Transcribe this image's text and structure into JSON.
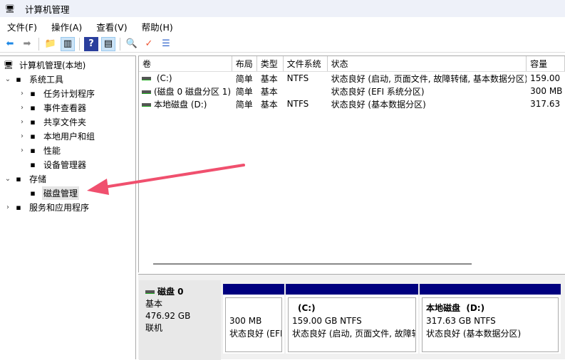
{
  "window": {
    "title": "计算机管理"
  },
  "menu": [
    "文件(F)",
    "操作(A)",
    "查看(V)",
    "帮助(H)"
  ],
  "tree": [
    {
      "label": "计算机管理(本地)",
      "icon": "computer-icon",
      "level": 0,
      "chev": ""
    },
    {
      "label": "系统工具",
      "icon": "tools-icon",
      "level": 1,
      "chev": "⌄"
    },
    {
      "label": "任务计划程序",
      "icon": "clock-icon",
      "level": 2,
      "chev": "›"
    },
    {
      "label": "事件查看器",
      "icon": "event-viewer-icon",
      "level": 2,
      "chev": "›"
    },
    {
      "label": "共享文件夹",
      "icon": "shared-folder-icon",
      "level": 2,
      "chev": "›"
    },
    {
      "label": "本地用户和组",
      "icon": "users-icon",
      "level": 2,
      "chev": "›"
    },
    {
      "label": "性能",
      "icon": "performance-icon",
      "level": 2,
      "chev": "›"
    },
    {
      "label": "设备管理器",
      "icon": "device-manager-icon",
      "level": 2,
      "chev": ""
    },
    {
      "label": "存储",
      "icon": "storage-icon",
      "level": 1,
      "chev": "⌄"
    },
    {
      "label": "磁盘管理",
      "icon": "disk-icon",
      "level": 2,
      "chev": "",
      "selected": true
    },
    {
      "label": "服务和应用程序",
      "icon": "services-icon",
      "level": 1,
      "chev": "›"
    }
  ],
  "table": {
    "columns": [
      "卷",
      "布局",
      "类型",
      "文件系统",
      "状态",
      "容量"
    ],
    "rows": [
      [
        " (C:)",
        "简单",
        "基本",
        "NTFS",
        "状态良好 (启动, 页面文件, 故障转储, 基本数据分区)",
        "159.00"
      ],
      [
        "(磁盘 0 磁盘分区 1)",
        "简单",
        "基本",
        "",
        "状态良好 (EFI 系统分区)",
        "300 MB"
      ],
      [
        "本地磁盘 (D:)",
        "简单",
        "基本",
        "NTFS",
        "状态良好 (基本数据分区)",
        "317.63"
      ]
    ]
  },
  "disk": {
    "name": "磁盘 0",
    "type": "基本",
    "size": "476.92 GB",
    "status": "联机",
    "partitions": [
      {
        "title": "",
        "size": "300 MB",
        "status": "状态良好 (EFI"
      },
      {
        "title": "(C:)",
        "size": "159.00 GB NTFS",
        "status": "状态良好 (启动, 页面文件, 故障转"
      },
      {
        "title": "本地磁盘  (D:)",
        "size": "317.63 GB NTFS",
        "status": "状态良好 (基本数据分区)"
      }
    ]
  },
  "colors": {
    "partition_bar": "#00007f",
    "arrow": "#f0506e"
  }
}
